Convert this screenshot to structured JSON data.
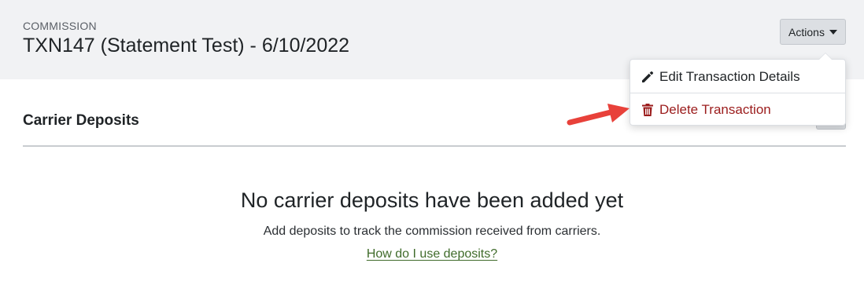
{
  "header": {
    "eyebrow": "COMMISSION",
    "title": "TXN147 (Statement Test) - 6/10/2022"
  },
  "actions": {
    "label": "Actions",
    "icon": "caret-down-icon",
    "menu": [
      {
        "label": "Edit Transaction Details",
        "icon": "pencil-icon",
        "color": "#1f2326"
      },
      {
        "label": "Delete Transaction",
        "icon": "trash-icon",
        "color": "#9b1c1c"
      }
    ]
  },
  "section": {
    "title": "Carrier Deposits"
  },
  "empty_state": {
    "heading": "No carrier deposits have been added yet",
    "description": "Add deposits to track the commission received from carriers.",
    "help_link": "How do I use deposits?"
  },
  "colors": {
    "accent_link": "#3f6b2a",
    "danger": "#9b1c1c",
    "callout_arrow": "#e8413a"
  }
}
